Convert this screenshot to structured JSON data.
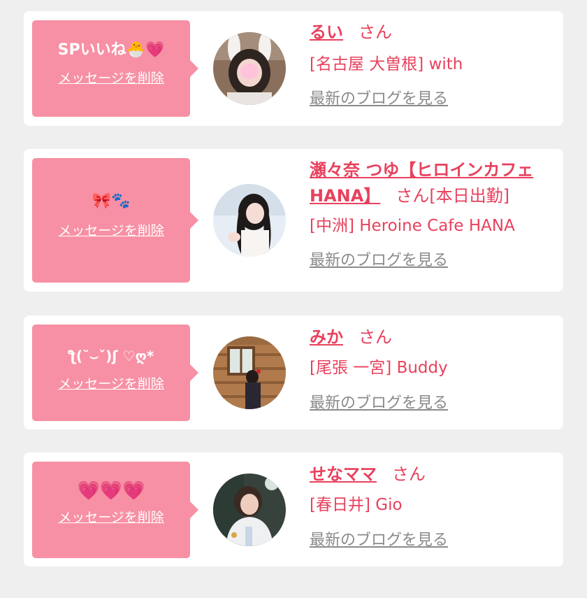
{
  "items": [
    {
      "message": "SPいいね🐣💗",
      "delete_label": "メッセージを削除",
      "name": "るい",
      "honorific": "さん",
      "extra": "",
      "shop": "[名古屋 大曽根] with",
      "blog_link": "最新のブログを見る"
    },
    {
      "message": "🎀🐾",
      "delete_label": "メッセージを削除",
      "name": "瀬々奈 つゆ【ヒロインカフェ HANA】",
      "honorific": "さん",
      "extra": "[本日出勤]",
      "shop": "[中洲] Heroine Cafe HANA",
      "blog_link": "最新のブログを見る"
    },
    {
      "message": "ƪ(˘⌣ˇ)ʃ ♡ღ*",
      "delete_label": "メッセージを削除",
      "name": "みか",
      "honorific": "さん",
      "extra": "",
      "shop": "[尾張 一宮] Buddy",
      "blog_link": "最新のブログを見る"
    },
    {
      "message": "💗💗💗",
      "delete_label": "メッセージを削除",
      "name": "せなママ",
      "honorific": "さん",
      "extra": "",
      "shop": "[春日井] Gio",
      "blog_link": "最新のブログを見る"
    }
  ],
  "colors": {
    "page_bg": "#efefef",
    "card_bg": "#ffffff",
    "bubble": "#f790a4",
    "name": "#e8415d",
    "blog_link": "#8a8a8a"
  }
}
